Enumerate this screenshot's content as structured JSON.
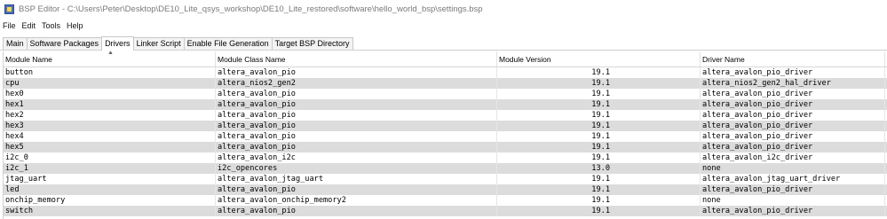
{
  "window": {
    "title": "BSP Editor - C:\\Users\\Peter\\Desktop\\DE10_Lite_qsys_workshop\\DE10_Lite_restored\\software\\hello_world_bsp\\settings.bsp"
  },
  "menu": [
    "File",
    "Edit",
    "Tools",
    "Help"
  ],
  "tabs": [
    "Main",
    "Software Packages",
    "Drivers",
    "Linker Script",
    "Enable File Generation",
    "Target BSP Directory"
  ],
  "active_tab": "Drivers",
  "table": {
    "columns": [
      "Module Name",
      "Module Class Name",
      "Module Version",
      "Driver Name"
    ],
    "rows": [
      [
        "button",
        "altera_avalon_pio",
        "19.1",
        "altera_avalon_pio_driver"
      ],
      [
        "cpu",
        "altera_nios2_gen2",
        "19.1",
        "altera_nios2_gen2_hal_driver"
      ],
      [
        "hex0",
        "altera_avalon_pio",
        "19.1",
        "altera_avalon_pio_driver"
      ],
      [
        "hex1",
        "altera_avalon_pio",
        "19.1",
        "altera_avalon_pio_driver"
      ],
      [
        "hex2",
        "altera_avalon_pio",
        "19.1",
        "altera_avalon_pio_driver"
      ],
      [
        "hex3",
        "altera_avalon_pio",
        "19.1",
        "altera_avalon_pio_driver"
      ],
      [
        "hex4",
        "altera_avalon_pio",
        "19.1",
        "altera_avalon_pio_driver"
      ],
      [
        "hex5",
        "altera_avalon_pio",
        "19.1",
        "altera_avalon_pio_driver"
      ],
      [
        "i2c_0",
        "altera_avalon_i2c",
        "19.1",
        "altera_avalon_i2c_driver"
      ],
      [
        "i2c_1",
        "i2c_opencores",
        "13.0",
        "none"
      ],
      [
        "jtag_uart",
        "altera_avalon_jtag_uart",
        "19.1",
        "altera_avalon_jtag_uart_driver"
      ],
      [
        "led",
        "altera_avalon_pio",
        "19.1",
        "altera_avalon_pio_driver"
      ],
      [
        "onchip_memory",
        "altera_avalon_onchip_memory2",
        "19.1",
        "none"
      ],
      [
        "switch",
        "altera_avalon_pio",
        "19.1",
        "altera_avalon_pio_driver"
      ]
    ]
  },
  "icons": {
    "app": "bsp-editor-icon",
    "sort": "sort-ascending-icon"
  }
}
